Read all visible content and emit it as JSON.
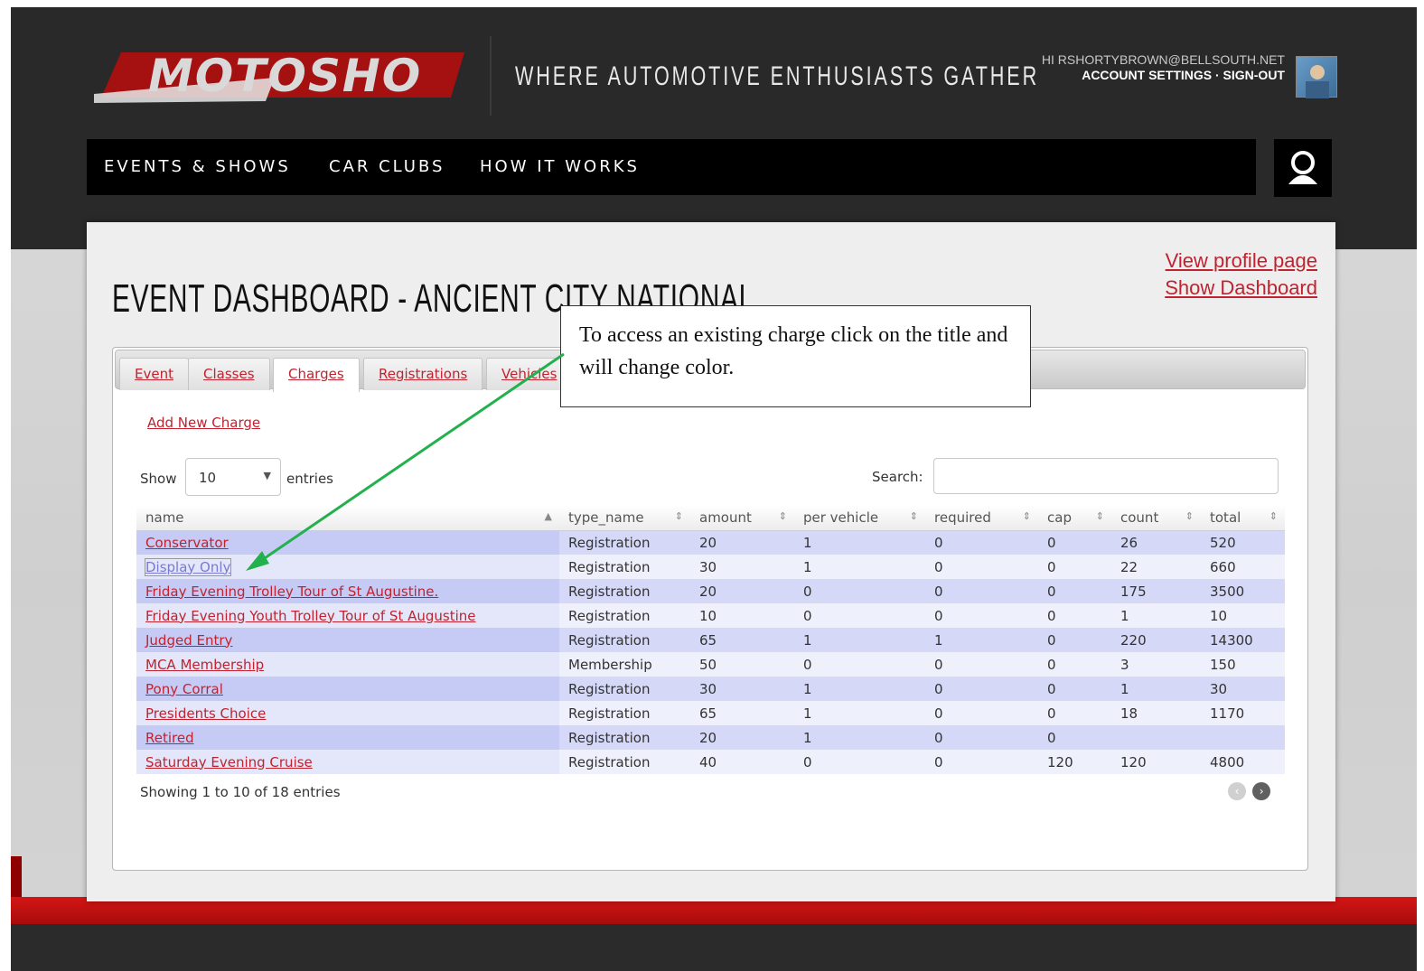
{
  "header": {
    "logo_text": "MOTOSHO",
    "tagline": "WHERE AUTOMOTIVE ENTHUSIASTS GATHER",
    "greeting": "HI RSHORTYBROWN@BELLSOUTH.NET",
    "account_settings": "ACCOUNT SETTINGS",
    "separator": "·",
    "sign_out": "SIGN-OUT"
  },
  "nav": {
    "items": [
      {
        "label": "EVENTS & SHOWS"
      },
      {
        "label": "CAR CLUBS"
      },
      {
        "label": "HOW IT WORKS"
      }
    ]
  },
  "page": {
    "title": "EVENT DASHBOARD - ANCIENT CITY NATIONAL",
    "view_profile": "View profile page",
    "show_dashboard": "Show Dashboard"
  },
  "tabs": [
    {
      "label": "Event"
    },
    {
      "label": "Classes"
    },
    {
      "label": "Charges",
      "active": true
    },
    {
      "label": "Registrations"
    },
    {
      "label": "Vehicles"
    }
  ],
  "charges": {
    "add_label": "Add New Charge",
    "show_label": "Show",
    "entries_per_page": "10",
    "entries_label": "entries",
    "search_label": "Search:",
    "search_value": "",
    "columns": [
      "name",
      "type_name",
      "amount",
      "per vehicle",
      "required",
      "cap",
      "count",
      "total"
    ],
    "rows": [
      {
        "name": "Conservator",
        "type_name": "Registration",
        "amount": "20",
        "per_vehicle": "1",
        "required": "0",
        "cap": "0",
        "count": "26",
        "total": "520"
      },
      {
        "name": "Display Only",
        "type_name": "Registration",
        "amount": "30",
        "per_vehicle": "1",
        "required": "0",
        "cap": "0",
        "count": "22",
        "total": "660"
      },
      {
        "name": "Friday Evening Trolley Tour of St Augustine.",
        "type_name": "Registration",
        "amount": "20",
        "per_vehicle": "0",
        "required": "0",
        "cap": "0",
        "count": "175",
        "total": "3500"
      },
      {
        "name": "Friday Evening Youth Trolley Tour of St Augustine",
        "type_name": "Registration",
        "amount": "10",
        "per_vehicle": "0",
        "required": "0",
        "cap": "0",
        "count": "1",
        "total": "10"
      },
      {
        "name": "Judged Entry",
        "type_name": "Registration",
        "amount": "65",
        "per_vehicle": "1",
        "required": "1",
        "cap": "0",
        "count": "220",
        "total": "14300"
      },
      {
        "name": "MCA Membership",
        "type_name": "Membership",
        "amount": "50",
        "per_vehicle": "0",
        "required": "0",
        "cap": "0",
        "count": "3",
        "total": "150"
      },
      {
        "name": "Pony Corral",
        "type_name": "Registration",
        "amount": "30",
        "per_vehicle": "1",
        "required": "0",
        "cap": "0",
        "count": "1",
        "total": "30"
      },
      {
        "name": "Presidents Choice",
        "type_name": "Registration",
        "amount": "65",
        "per_vehicle": "1",
        "required": "0",
        "cap": "0",
        "count": "18",
        "total": "1170"
      },
      {
        "name": "Retired",
        "type_name": "Registration",
        "amount": "20",
        "per_vehicle": "1",
        "required": "0",
        "cap": "0",
        "count": "",
        "total": ""
      },
      {
        "name": "Saturday Evening Cruise",
        "type_name": "Registration",
        "amount": "40",
        "per_vehicle": "0",
        "required": "0",
        "cap": "120",
        "count": "120",
        "total": "4800"
      }
    ],
    "info": "Showing 1 to 10 of 18 entries"
  },
  "callout": {
    "text": "To access an existing charge click on the title and will change color.",
    "arrow_color": "#22b14c"
  },
  "colors": {
    "accent": "#c0232f",
    "header_bg": "#292929",
    "footer_red": "#c41010"
  }
}
